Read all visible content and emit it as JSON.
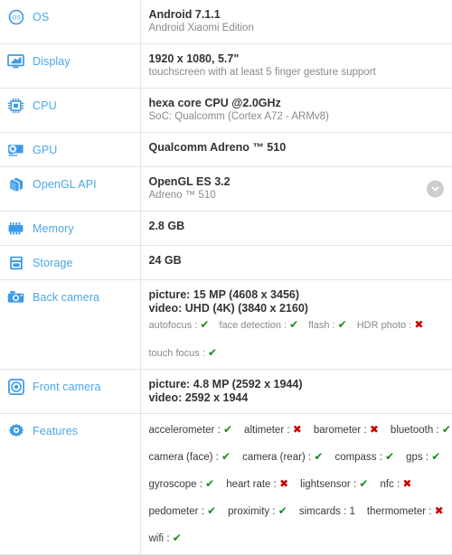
{
  "theme": {
    "label_color": "#4ba7ed",
    "value_color": "#333333",
    "secondary_color": "#8a8a8a",
    "yes_color": "#1a8a1a",
    "no_color": "#cc0000",
    "divider_color": "#e4e4e4"
  },
  "glyphs": {
    "yes": "✔",
    "no": "✖"
  },
  "rows": [
    {
      "id": "os",
      "label": "OS",
      "icon": "os-icon",
      "primary": "Android 7.1.1",
      "secondary": "Android Xiaomi Edition"
    },
    {
      "id": "display",
      "label": "Display",
      "icon": "monitor-icon",
      "primary": "1920 x 1080, 5.7\"",
      "secondary": "touchscreen with at least 5 finger gesture support"
    },
    {
      "id": "cpu",
      "label": "CPU",
      "icon": "chip-icon",
      "primary": "hexa core CPU @2.0GHz",
      "secondary": "SoC: Qualcomm (Cortex A72 - ARMv8)"
    },
    {
      "id": "gpu",
      "label": "GPU",
      "icon": "gpu-card-icon",
      "primary": "Qualcomm Adreno ™ 510",
      "secondary": ""
    },
    {
      "id": "opengl-api",
      "label": "OpenGL API",
      "icon": "cube-icon",
      "primary": "OpenGL ES 3.2",
      "secondary": "Adreno ™ 510",
      "has_expand": true,
      "expand_label": "chevron-down"
    },
    {
      "id": "memory",
      "label": "Memory",
      "icon": "memory-icon",
      "primary": "2.8 GB",
      "secondary": ""
    },
    {
      "id": "storage",
      "label": "Storage",
      "icon": "storage-icon",
      "primary": "24 GB",
      "secondary": ""
    }
  ],
  "back_camera": {
    "id": "back-camera",
    "label": "Back camera",
    "icon": "camera-icon",
    "primary": "picture: 15 MP (4608 x 3456)",
    "primary2": "video: UHD (4K) (3840 x 2160)",
    "features_line1": [
      {
        "name": "autofocus",
        "sep": ":",
        "value": "yes"
      },
      {
        "name": "face detection",
        "sep": ":",
        "value": "yes"
      },
      {
        "name": "flash",
        "sep": ":",
        "value": "yes"
      },
      {
        "name": "HDR photo",
        "sep": ":",
        "value": "no"
      }
    ],
    "features_line2": [
      {
        "name": "touch focus",
        "sep": ":",
        "value": "yes"
      }
    ]
  },
  "front_camera": {
    "id": "front-camera",
    "label": "Front camera",
    "icon": "front-camera-icon",
    "primary": "picture: 4.8 MP (2592 x 1944)",
    "primary2": "video: 2592 x 1944"
  },
  "features": {
    "id": "features",
    "label": "Features",
    "icon": "gear-icon",
    "lines": [
      [
        {
          "name": "accelerometer",
          "sep": ":",
          "value": "yes"
        },
        {
          "name": "altimeter",
          "sep": ":",
          "value": "no"
        },
        {
          "name": "barometer",
          "sep": ":",
          "value": "no"
        },
        {
          "name": "bluetooth",
          "sep": ":",
          "value": "yes"
        }
      ],
      [
        {
          "name": "camera (face)",
          "sep": ":",
          "value": "yes"
        },
        {
          "name": "camera (rear)",
          "sep": ":",
          "value": "yes"
        },
        {
          "name": "compass",
          "sep": ":",
          "value": "yes"
        },
        {
          "name": "gps",
          "sep": ":",
          "value": "yes"
        }
      ],
      [
        {
          "name": "gyroscope",
          "sep": ":",
          "value": "yes"
        },
        {
          "name": "heart rate",
          "sep": ":",
          "value": "no"
        },
        {
          "name": "lightsensor",
          "sep": ":",
          "value": "yes"
        },
        {
          "name": "nfc",
          "sep": ":",
          "value": "no"
        }
      ],
      [
        {
          "name": "pedometer",
          "sep": ":",
          "value": "yes"
        },
        {
          "name": "proximity",
          "sep": ":",
          "value": "yes"
        },
        {
          "name": "simcards",
          "sep": ":",
          "value": "1"
        },
        {
          "name": "thermometer",
          "sep": ":",
          "value": "no"
        }
      ],
      [
        {
          "name": "wifi",
          "sep": ":",
          "value": "yes"
        }
      ]
    ]
  }
}
